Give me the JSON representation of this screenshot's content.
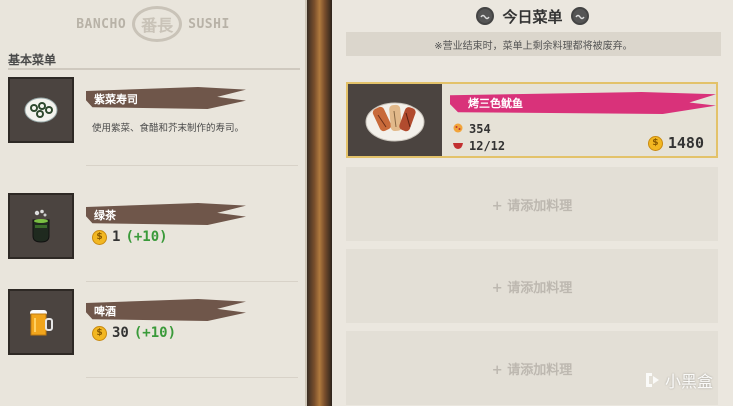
{
  "brand": {
    "left": "BANCHO",
    "seal": "番長",
    "right": "SUSHI"
  },
  "basic_menu": {
    "title": "基本菜单",
    "items": [
      {
        "name": "紫菜寿司",
        "description": "使用紫菜、食醋和芥末制作的寿司。",
        "icon": "sushi-roll-icon"
      },
      {
        "name": "绿茶",
        "price": "1",
        "bonus": "(+10)",
        "icon": "green-tea-icon"
      },
      {
        "name": "啤酒",
        "price": "30",
        "bonus": "(+10)",
        "icon": "beer-icon"
      }
    ]
  },
  "today_menu": {
    "title": "今日菜单",
    "notice": "※营业结束时，菜单上剩余料理都将被废弃。",
    "dish": {
      "name": "烤三色鱿鱼",
      "taste": "354",
      "stock": "12/12",
      "price": "1480",
      "icon": "grilled-squid-icon"
    },
    "empty_slots": [
      "+ 请添加料理",
      "+ 请添加料理",
      "+ 请添加料理"
    ]
  },
  "watermark": "小黑盒",
  "colors": {
    "panel": "#e9e5dc",
    "brush_brown": "#6f564a",
    "brush_pink": "#d9327a",
    "selected_border": "#e3c26a",
    "coin": "#f2b722",
    "bonus_green": "#3a9a3a"
  }
}
